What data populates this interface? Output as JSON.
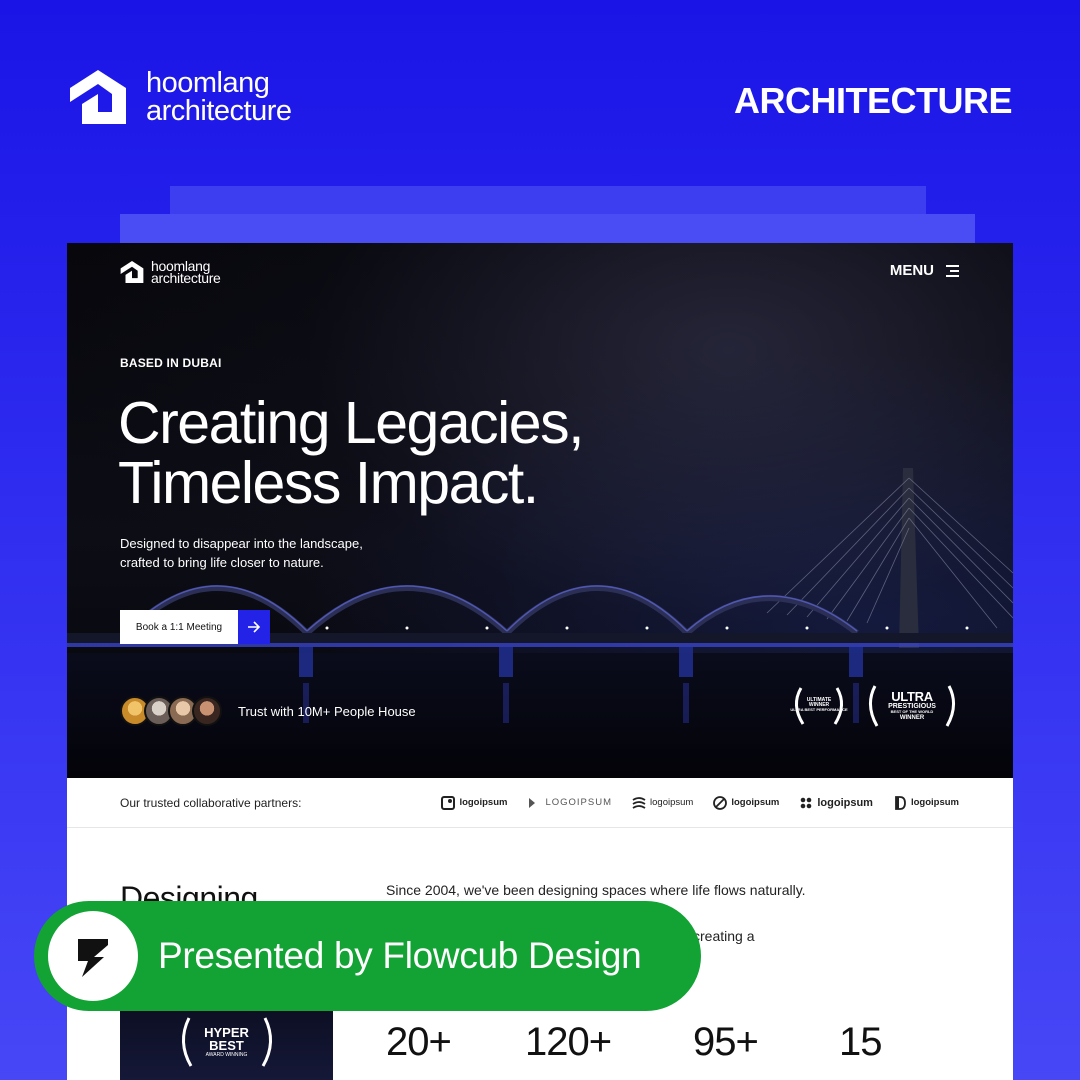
{
  "brand": {
    "line1": "hoomlang",
    "line2": "architecture"
  },
  "category": "ARCHITECTURE",
  "site": {
    "logo": {
      "line1": "hoomlang",
      "line2": "architecture"
    },
    "menu_label": "MENU",
    "eyebrow": "BASED IN DUBAI",
    "headline": {
      "line1": "Creating Legacies,",
      "line2": "Timeless Impact."
    },
    "subtext": {
      "line1": "Designed to disappear into the landscape,",
      "line2": "crafted to bring life closer to nature."
    },
    "cta_label": "Book a 1:1 Meeting",
    "trust_text": "Trust with 10M+ People House",
    "awards": [
      {
        "top": "ULTIMATE",
        "main": "WINNER",
        "bottom": "ULTRA BEST PERFORMANCE"
      },
      {
        "top": "",
        "main": "ULTRA",
        "sub": "PRESTIGIOUS",
        "bottom": "BEST OF THE WORLD",
        "foot": "WINNER"
      }
    ],
    "partners_label": "Our trusted collaborative partners:",
    "partners": [
      "logoipsum",
      "LOGOIPSUM",
      "logoipsum",
      "logoipsum",
      "logoipsum",
      "logoipsum"
    ],
    "about": {
      "title": "Designing",
      "p1": "Since 2004, we've been designing spaces where life flows naturally.",
      "p2": "creating a",
      "badge": {
        "main1": "HYPER",
        "main2": "BEST",
        "sub": "AWARD WINNING"
      },
      "stats": [
        "20+",
        "120+",
        "95+",
        "15"
      ]
    }
  },
  "presenter": {
    "text": "Presented by Flowcub Design"
  },
  "colors": {
    "background": "#2f2cf0",
    "accent": "#2323e8",
    "presenter": "#12a334"
  }
}
